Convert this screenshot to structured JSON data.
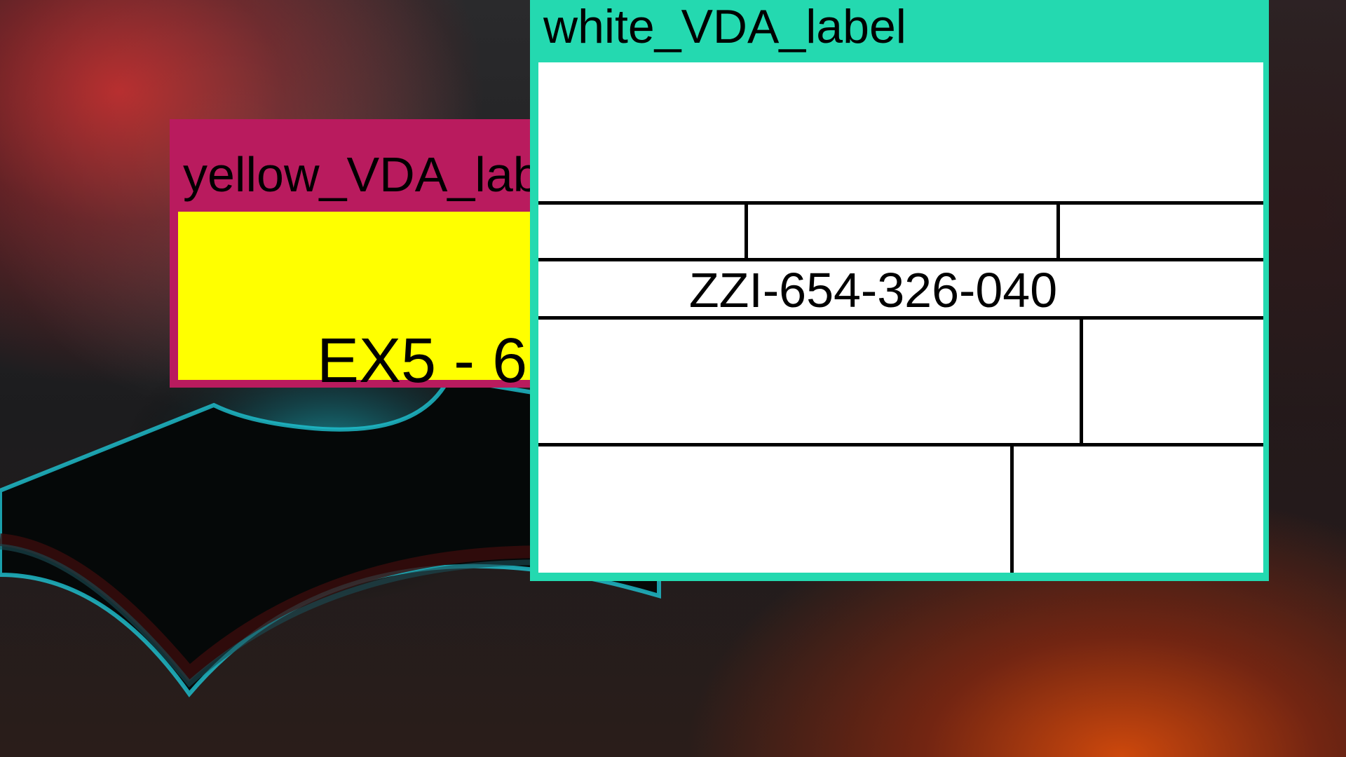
{
  "windows": {
    "yellow": {
      "title": "yellow_VDA_label",
      "content_text": "EX5 - 6",
      "title_bar_color": "#b91b5e",
      "content_color": "#ffff00"
    },
    "white": {
      "title": "white_VDA_label",
      "code": "ZZI-654-326-040",
      "title_bar_color": "#24d9b0",
      "content_color": "#ffffff"
    }
  },
  "desktop": {
    "wallpaper_colors": [
      "#c02a2a",
      "#1c1c1e",
      "#d0480c",
      "#1fc6d4"
    ]
  }
}
